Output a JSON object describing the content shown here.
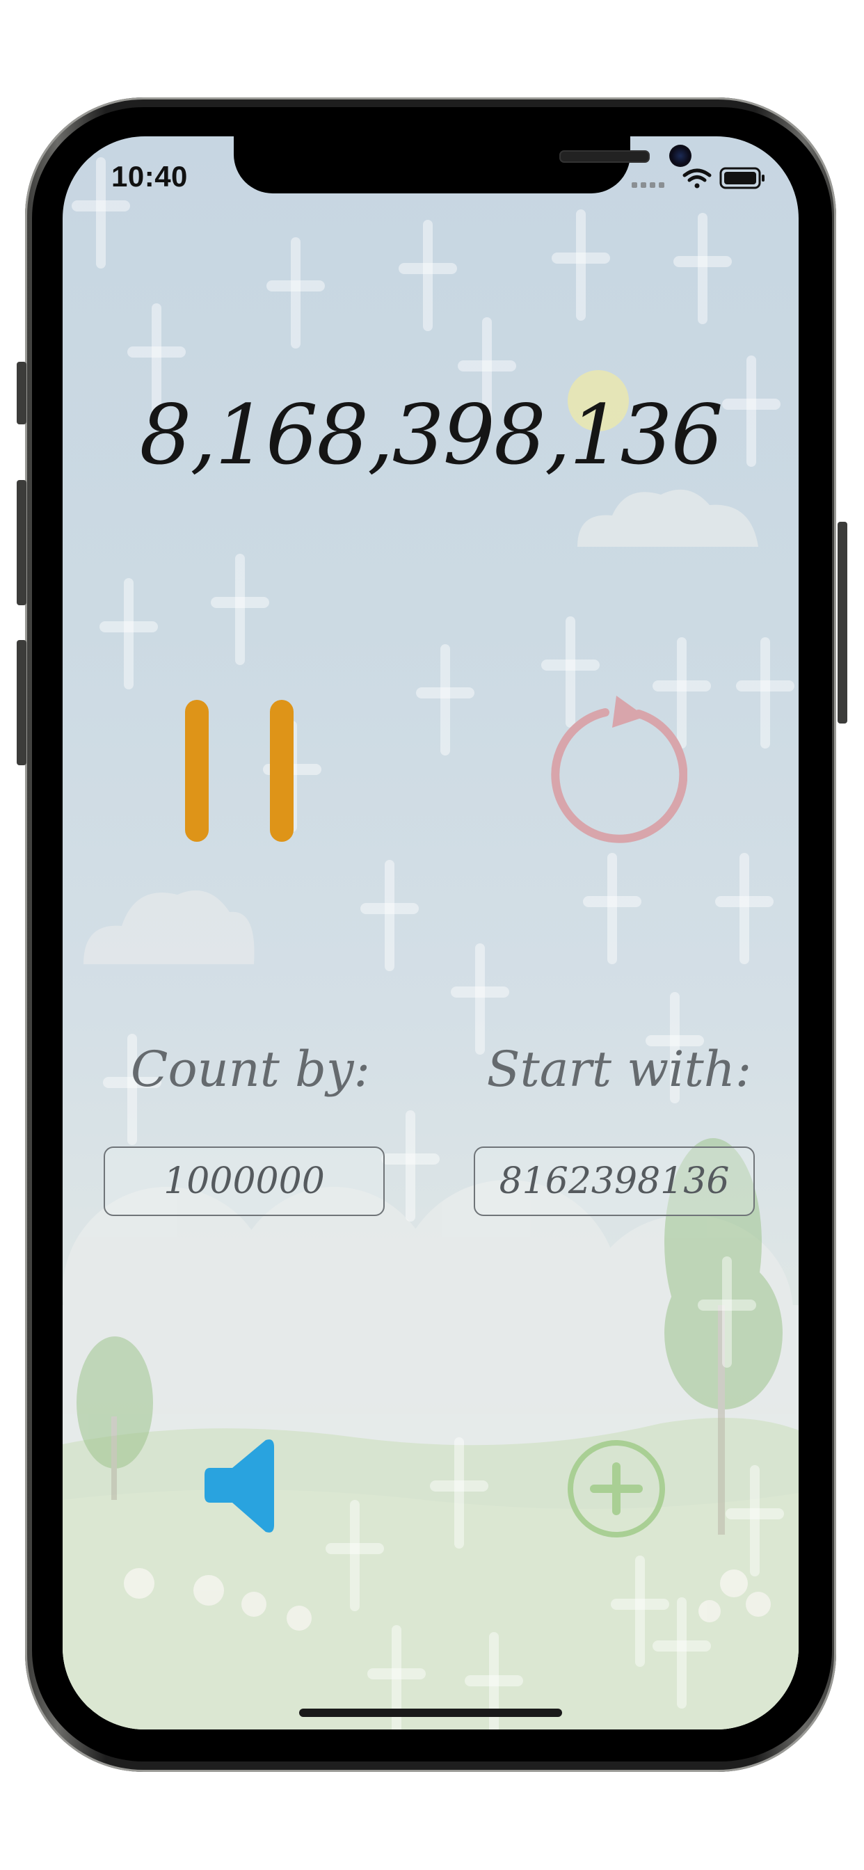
{
  "status_bar": {
    "time": "10:40"
  },
  "counter": {
    "value": "8,168,398,136"
  },
  "controls": {
    "pause_icon": "pause-icon",
    "restart_icon": "restart-icon",
    "sound_icon": "speaker-icon",
    "add_icon": "plus-circle-icon"
  },
  "settings": {
    "count_by_label": "Count by:",
    "count_by_value": "1000000",
    "start_with_label": "Start with:",
    "start_with_value": "8162398136"
  },
  "colors": {
    "pause": "#de9418",
    "restart": "#d8a5ab",
    "sound": "#29a3df",
    "add": "#a9cf94",
    "counter_text": "#151515"
  }
}
